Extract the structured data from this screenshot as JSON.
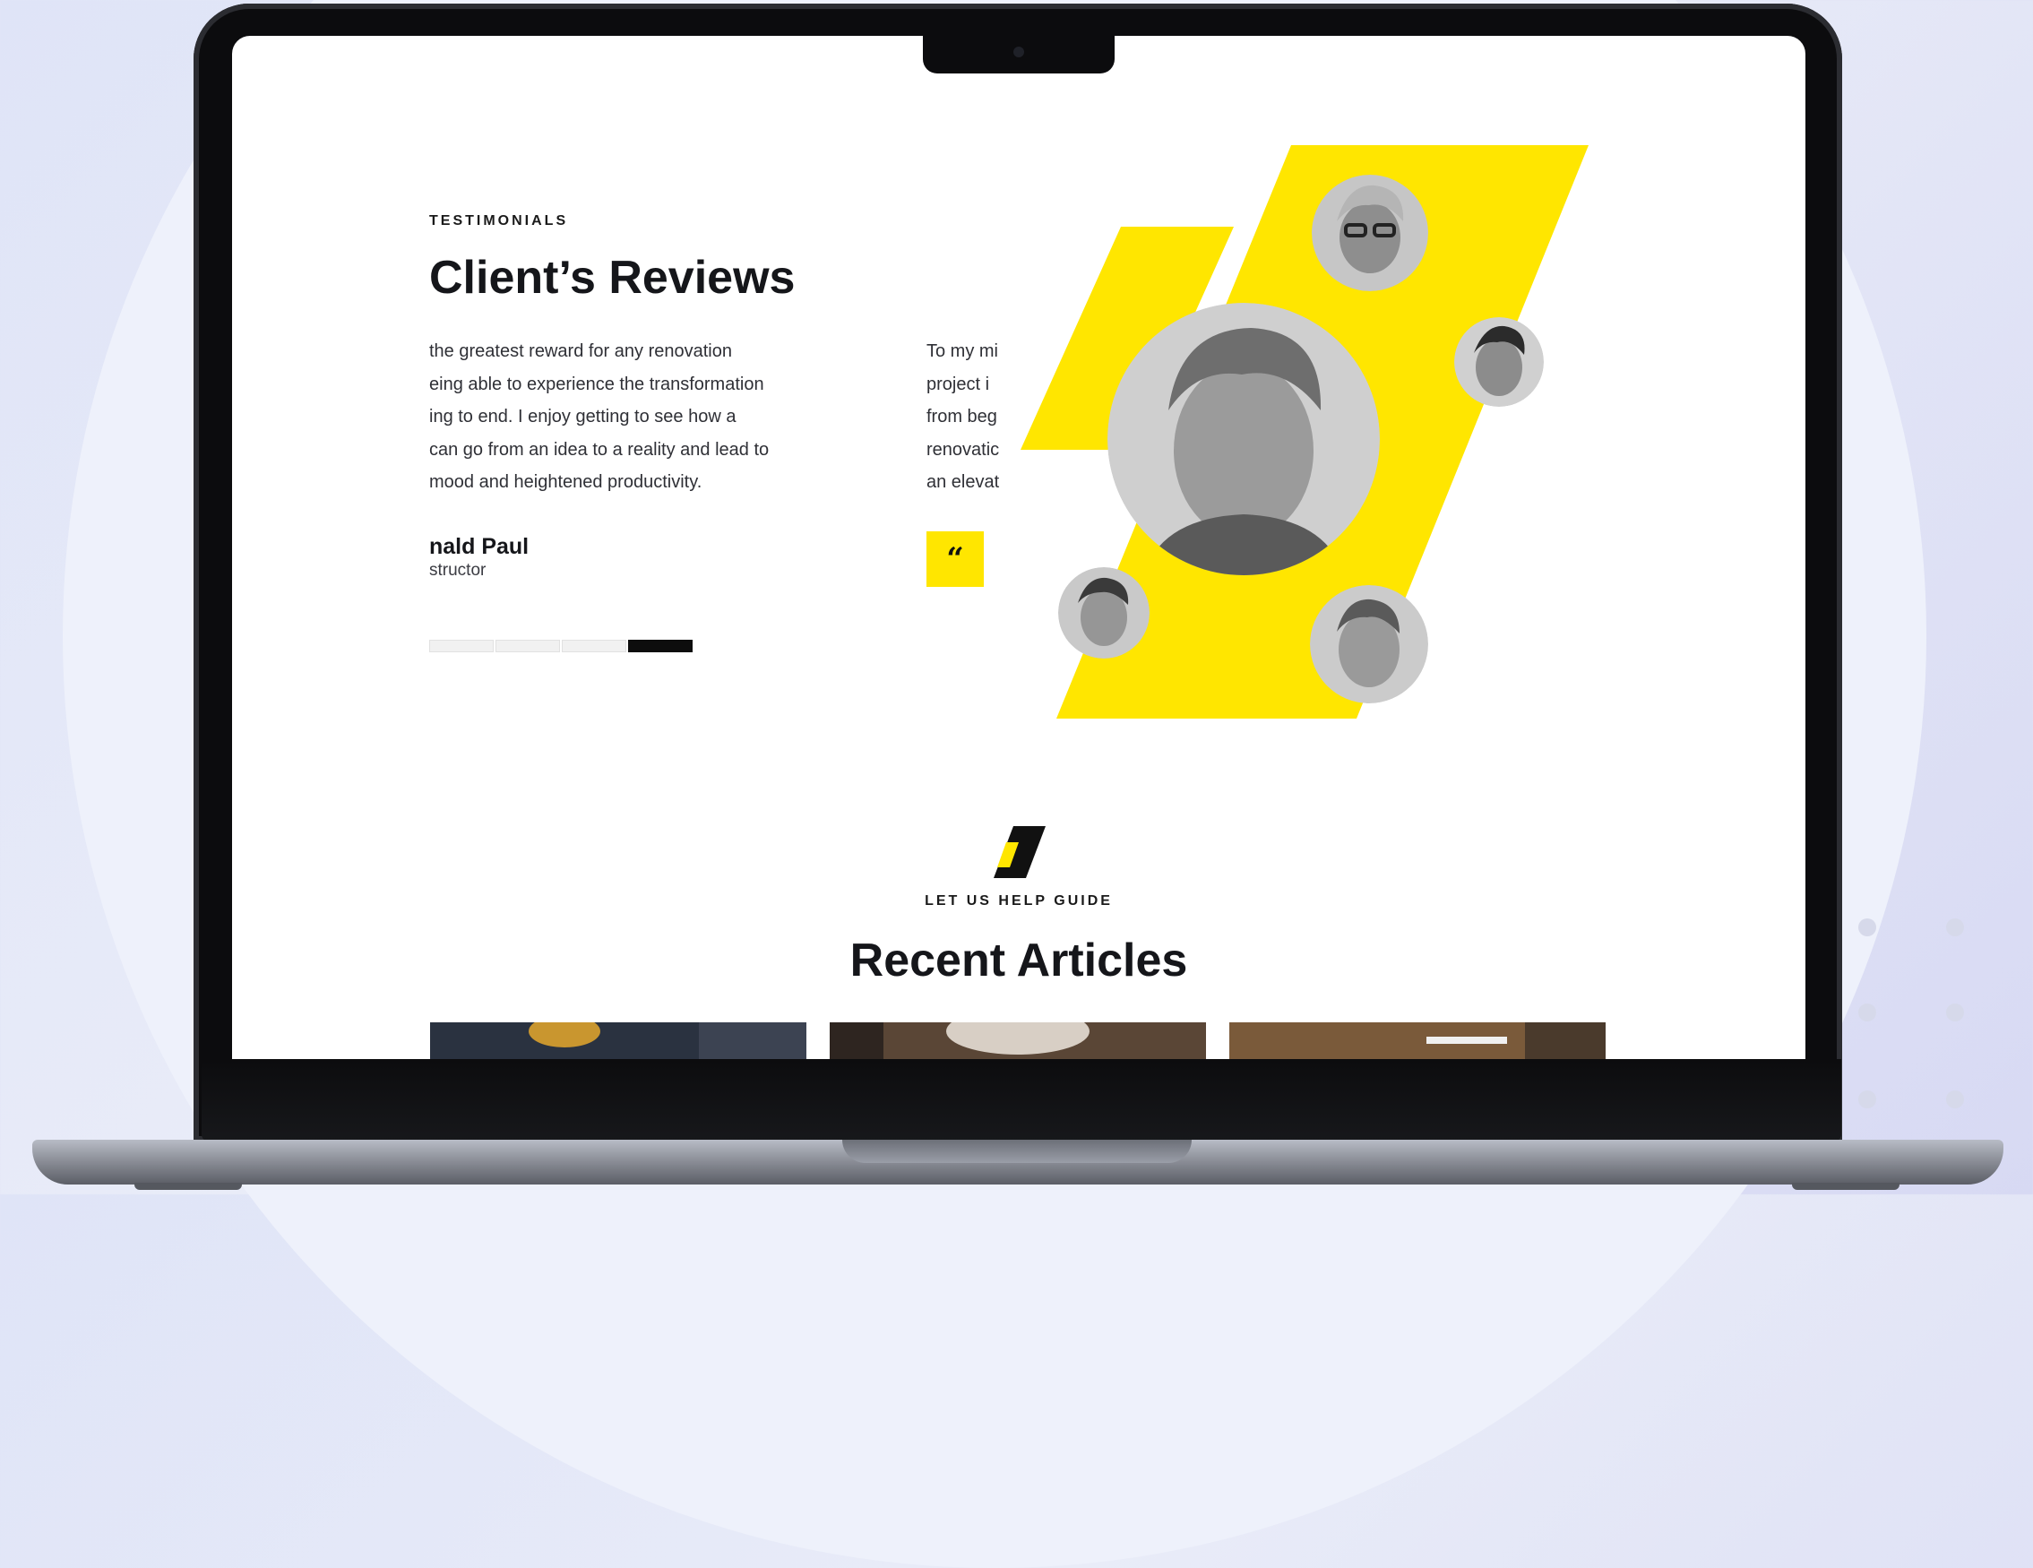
{
  "testimonials": {
    "eyebrow": "TESTIMONIALS",
    "title": "Client’s Reviews",
    "review_1": {
      "lines": [
        "the greatest reward for any renovation",
        "eing able to experience the transformation",
        "ing to end. I enjoy getting to see how a",
        "can go from an idea to a reality and lead to",
        "mood and heightened productivity."
      ],
      "author": "nald Paul",
      "role": "structor"
    },
    "review_2": {
      "lines": [
        "To my mi",
        "project i",
        "from beg",
        "renovatic",
        "an elevat"
      ],
      "quote_icon": "“"
    },
    "pager_count": 4,
    "pager_active": 4
  },
  "articles": {
    "eyebrow": "LET US HELP GUIDE",
    "title": "Recent Articles"
  },
  "colors": {
    "accent": "#ffe600",
    "text": "#15161a"
  },
  "icons": [
    "quote-icon",
    "brand-logo-icon"
  ]
}
